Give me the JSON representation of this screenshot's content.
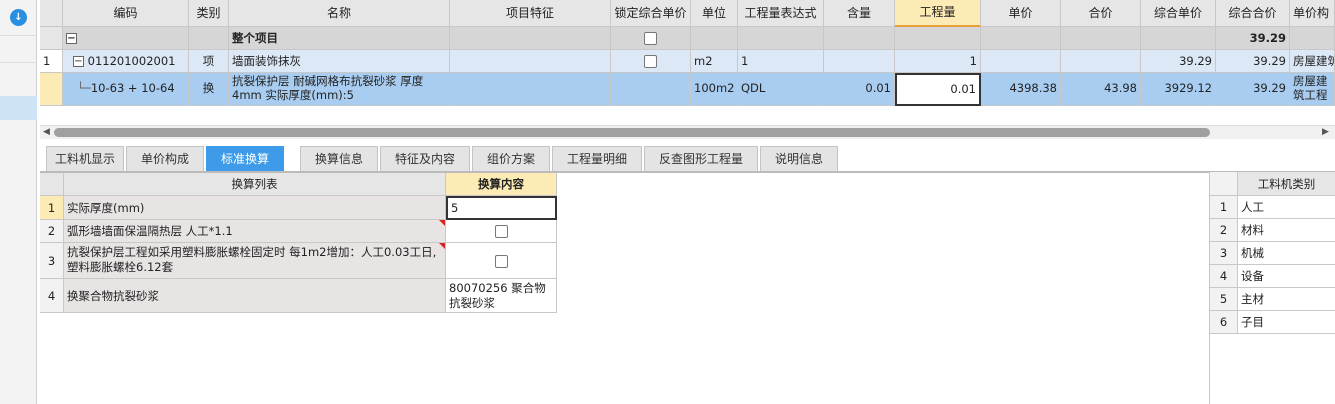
{
  "grid": {
    "headers": [
      "编码",
      "类别",
      "名称",
      "项目特征",
      "锁定综合单价",
      "单位",
      "工程量表达式",
      "含量",
      "工程量",
      "单价",
      "合价",
      "综合单价",
      "综合合价",
      "单价构"
    ],
    "rows": [
      {
        "index": "",
        "toggle": "−",
        "code": "",
        "type": "",
        "name": "整个项目",
        "unit": "",
        "expr": "",
        "content": "",
        "qty": "",
        "price": "",
        "total": "",
        "unit_total": "",
        "comp_total": "39.29",
        "extra": "",
        "locked": false
      },
      {
        "index": "1",
        "toggle": "−",
        "code": "011201002001",
        "type": "项",
        "name": "墙面装饰抹灰",
        "unit": "m2",
        "expr": "1",
        "content": "",
        "qty": "1",
        "price": "",
        "total": "",
        "unit_total": "39.29",
        "comp_total": "39.29",
        "extra": "房屋建筑",
        "locked": false
      },
      {
        "index": "",
        "toggle": "",
        "code": "10-63 + 10-64",
        "type": "换",
        "name": "抗裂保护层 耐碱网格布抗裂砂浆 厚度4mm  实际厚度(mm):5",
        "unit": "100m2",
        "expr": "QDL",
        "content": "0.01",
        "qty": "0.01",
        "price": "4398.38",
        "total": "43.98",
        "unit_total": "3929.12",
        "comp_total": "39.29",
        "extra": "房屋建筑工程"
      }
    ]
  },
  "tabs": [
    "工料机显示",
    "单价构成",
    "标准换算",
    "换算信息",
    "特征及内容",
    "组价方案",
    "工程量明细",
    "反查图形工程量",
    "说明信息"
  ],
  "active_tab": "标准换算",
  "conversion": {
    "headers": [
      "换算列表",
      "换算内容"
    ],
    "rows": [
      {
        "index": "1",
        "label": "实际厚度(mm)",
        "value": "5"
      },
      {
        "index": "2",
        "label": "弧形墙墙面保温隔热层 人工*1.1",
        "value": ""
      },
      {
        "index": "3",
        "label": "抗裂保护层工程如采用塑料膨胀螺栓固定时 每1m2增加：人工0.03工日,塑料膨胀螺栓6.12套",
        "value": ""
      },
      {
        "index": "4",
        "label": "换聚合物抗裂砂浆",
        "value": "80070256  聚合物抗裂砂浆"
      }
    ]
  },
  "material_types": {
    "header": "工料机类别",
    "rows": [
      {
        "index": "1",
        "label": "人工"
      },
      {
        "index": "2",
        "label": "材料"
      },
      {
        "index": "3",
        "label": "机械"
      },
      {
        "index": "4",
        "label": "设备"
      },
      {
        "index": "5",
        "label": "主材"
      },
      {
        "index": "6",
        "label": "子目"
      }
    ]
  },
  "colors": {
    "accent": "#3d9be9",
    "highlight": "#fcebb5",
    "row_selected": "#a9cdf1"
  }
}
